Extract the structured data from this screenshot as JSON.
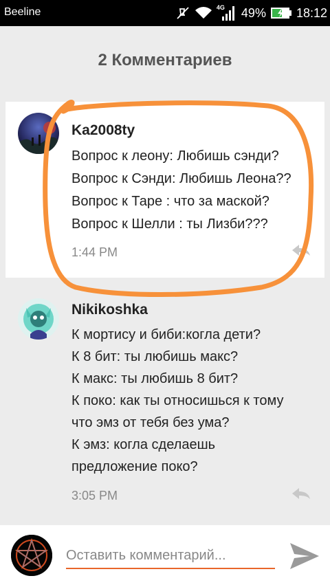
{
  "status_bar": {
    "carrier": "Beeline",
    "network_type": "4G",
    "battery": "49%",
    "time": "18:12",
    "icons": [
      "mute-icon",
      "wifi-icon",
      "signal-icon",
      "battery-icon"
    ]
  },
  "header": {
    "title": "2 Комментариев"
  },
  "comments": [
    {
      "author": "Ka2008ty",
      "lines": [
        "Вопрос к леону: Любишь сэнди?",
        "Вопрос к Сэнди: Любишь Леона??",
        "Вопрос к Таре : что за маской?",
        "Вопрос к Шелли : ты Лизби???"
      ],
      "time": "1:44 PM"
    },
    {
      "author": "Nikikoshka",
      "lines": [
        "К мортису и биби:когла дети?",
        "К 8 бит: ты любишь макс?",
        "К макс: ты любишь 8 бит?",
        "К поко: как ты относишься к тому",
        "что эмз от тебя без ума?",
        "К эмз: когла сделаешь",
        "предложение поко?"
      ],
      "time": "3:05 PM"
    }
  ],
  "input": {
    "placeholder": "Оставить комментарий..."
  },
  "colors": {
    "accent": "#e8652a",
    "highlight_stroke": "#f7913a",
    "background": "#ececec"
  }
}
